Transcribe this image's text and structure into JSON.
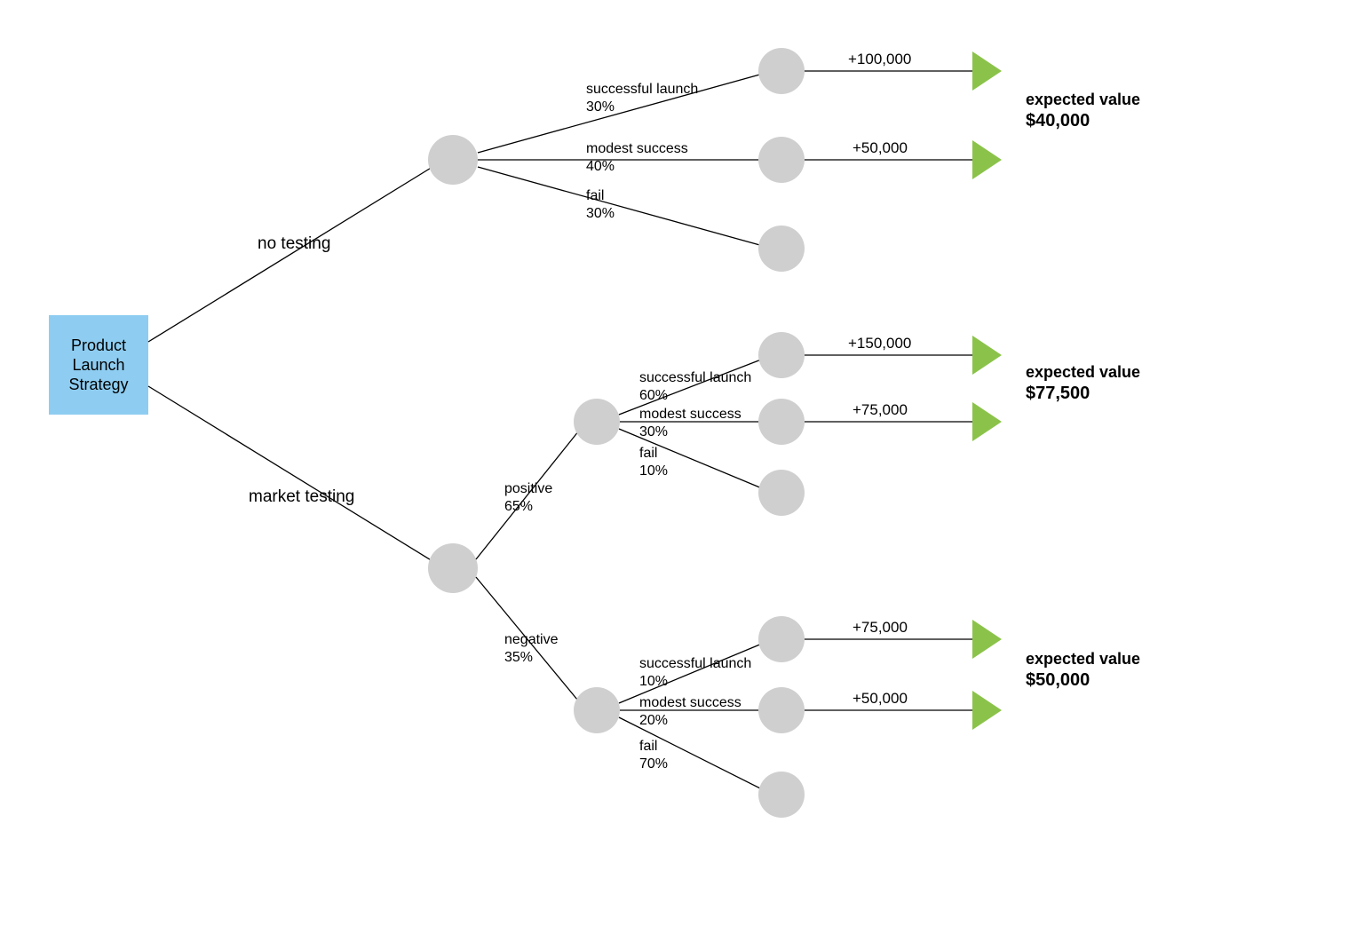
{
  "chart_data": {
    "type": "table",
    "title": "Product Launch Strategy — decision tree",
    "decisions": [
      {
        "name": "no testing",
        "outcomes": [
          {
            "label": "successful launch",
            "prob": 0.3,
            "payoff": 100000
          },
          {
            "label": "modest success",
            "prob": 0.4,
            "payoff": 50000
          },
          {
            "label": "fail",
            "prob": 0.3,
            "payoff": 0
          }
        ],
        "expected_value": 40000
      },
      {
        "name": "market testing",
        "tests": [
          {
            "result": "positive",
            "prob": 0.65,
            "outcomes": [
              {
                "label": "successful launch",
                "prob": 0.6,
                "payoff": 150000
              },
              {
                "label": "modest success",
                "prob": 0.3,
                "payoff": 75000
              },
              {
                "label": "fail",
                "prob": 0.1,
                "payoff": 0
              }
            ],
            "expected_value": 77500
          },
          {
            "result": "negative",
            "prob": 0.35,
            "outcomes": [
              {
                "label": "successful launch",
                "prob": 0.1,
                "payoff": 75000
              },
              {
                "label": "modest success",
                "prob": 0.2,
                "payoff": 50000
              },
              {
                "label": "fail",
                "prob": 0.7,
                "payoff": 0
              }
            ],
            "expected_value": 50000
          }
        ]
      }
    ]
  },
  "root_label_l1": "Product",
  "root_label_l2": "Launch",
  "root_label_l3": "Strategy",
  "branch_no_testing": "no testing",
  "branch_market_testing": "market testing",
  "nt_success_label": "successful launch",
  "nt_success_pct": "30%",
  "nt_modest_label": "modest success",
  "nt_modest_pct": "40%",
  "nt_fail_label": "fail",
  "nt_fail_pct": "30%",
  "nt_success_value": "+100,000",
  "nt_modest_value": "+50,000",
  "positive_label": "positive",
  "positive_pct": "65%",
  "negative_label": "negative",
  "negative_pct": "35%",
  "pos_success_label": "successful launch",
  "pos_success_pct": "60%",
  "pos_modest_label": "modest success",
  "pos_modest_pct": "30%",
  "pos_fail_label": "fail",
  "pos_fail_pct": "10%",
  "pos_success_value": "+150,000",
  "pos_modest_value": "+75,000",
  "neg_success_label": "successful launch",
  "neg_success_pct": "10%",
  "neg_modest_label": "modest success",
  "neg_modest_pct": "20%",
  "neg_fail_label": "fail",
  "neg_fail_pct": "70%",
  "neg_success_value": "+75,000",
  "neg_modest_value": "+50,000",
  "ev_label": "expected value",
  "ev_nt": "$40,000",
  "ev_pos": "$77,500",
  "ev_neg": "$50,000"
}
